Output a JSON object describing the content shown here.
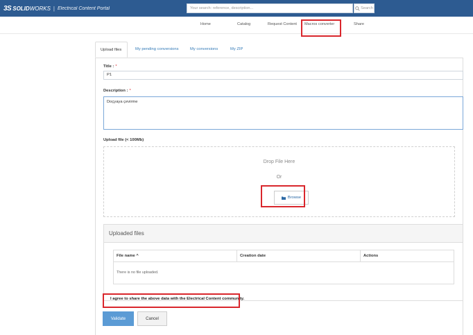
{
  "header": {
    "brand_ds": "3S",
    "brand_solid": "SOLID",
    "brand_works": "WORKS",
    "separator": "|",
    "portal_title": "Electrical Content Portal",
    "search_placeholder": "Your search: reference, description...",
    "search_button": "Search"
  },
  "nav": {
    "items": [
      "Home",
      "Catalog",
      "Request Content",
      "Macros converter",
      "Share"
    ],
    "highlighted": "Macros converter"
  },
  "tabs": [
    "Upload files",
    "My pending conversions",
    "My conversions",
    "My ZIP"
  ],
  "form": {
    "title_label": "Title :",
    "title_required": "*",
    "title_value": "P1",
    "description_label": "Description :",
    "description_required": "*",
    "description_value": "Doçyaya çevirme",
    "upload_label": "Upload file (< 100Mb)",
    "drop_text": "Drop File Here",
    "or_text": "Or",
    "browse_label": "Browse"
  },
  "uploaded": {
    "heading": "Uploaded files",
    "columns": [
      "File name ^",
      "Creation date",
      "Actions"
    ],
    "empty_text": "There is no file uploaded."
  },
  "agree_text": "I agree to share the above data with the Electrical Content community.",
  "actions": {
    "validate": "Validate",
    "cancel": "Cancel"
  },
  "colors": {
    "header_bg": "#2d5b91",
    "highlight": "#d9262c",
    "primary_button": "#5b9bd5",
    "link": "#337ab7"
  }
}
